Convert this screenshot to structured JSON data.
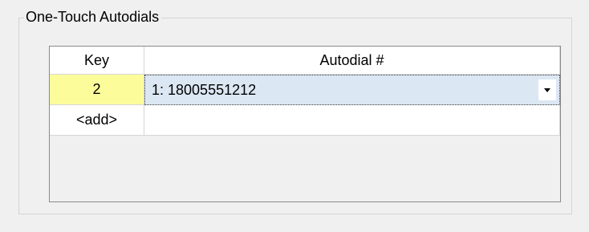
{
  "groupbox": {
    "title": "One-Touch Autodials"
  },
  "grid": {
    "columns": [
      "Key",
      "Autodial #"
    ],
    "rows": [
      {
        "key": "2",
        "autodial": "1: 18005551212",
        "has_dropdown": true
      },
      {
        "key": "<add>",
        "autodial": "",
        "has_dropdown": false
      }
    ]
  },
  "icons": {
    "dropdown": "chevron-down-icon"
  },
  "colors": {
    "key_cell_highlight": "#fdfc9b",
    "selected_cell": "#dce7f4",
    "grid_background": "#f0f0f0"
  }
}
